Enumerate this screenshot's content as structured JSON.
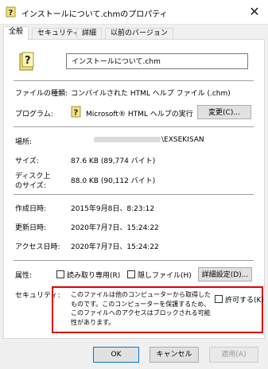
{
  "window": {
    "title": "インストールについて.chmのプロパティ",
    "close_glyph": "✕"
  },
  "tabs": [
    {
      "label": "全般"
    },
    {
      "label": "セキュリティ"
    },
    {
      "label": "詳細"
    },
    {
      "label": "以前のバージョン"
    }
  ],
  "file": {
    "name": "インストールについて.chm"
  },
  "rows": {
    "type": {
      "label": "ファイルの種類:",
      "value": "コンパイルされた HTML ヘルプ ファイル (.chm)"
    },
    "program": {
      "label": "プログラム:",
      "value": "Microsoft® HTML ヘルプの実行",
      "change_button": "変更(C)..."
    },
    "location": {
      "label": "場所:",
      "value": "\\EXSEKISAN"
    },
    "size": {
      "label": "サイズ:",
      "value": "87.6 KB (89,774 バイト)"
    },
    "disk_size": {
      "label_line1": "ディスク上",
      "label_line2": "のサイズ:",
      "value": "88.0 KB (90,112 バイト)"
    },
    "created": {
      "label": "作成日時:",
      "value": "2015年9月8日、8:23:12"
    },
    "modified": {
      "label": "更新日時:",
      "value": "2020年7月7日、15:24:22"
    },
    "accessed": {
      "label": "アクセス日時:",
      "value": "2020年7月7日、15:24:22"
    }
  },
  "attributes": {
    "label": "属性:",
    "readonly": "読み取り専用(R)",
    "hidden": "隠しファイル(H)",
    "advanced_button": "詳細設定(D)..."
  },
  "security": {
    "label": "セキュリティ:",
    "message": "このファイルは他のコンピューターから取得したものです。このコンピューターを保護するため、このファイルへのアクセスはブロックされる可能性があります。",
    "allow": "許可する(K)"
  },
  "footer": {
    "ok": "OK",
    "cancel": "キャンセル",
    "apply": "適用(A)"
  },
  "colors": {
    "highlight": "#e00000",
    "accent": "#0078d7"
  },
  "icons": {
    "title": "chm-help-icon",
    "file": "chm-help-icon",
    "program": "help-exec-icon"
  }
}
